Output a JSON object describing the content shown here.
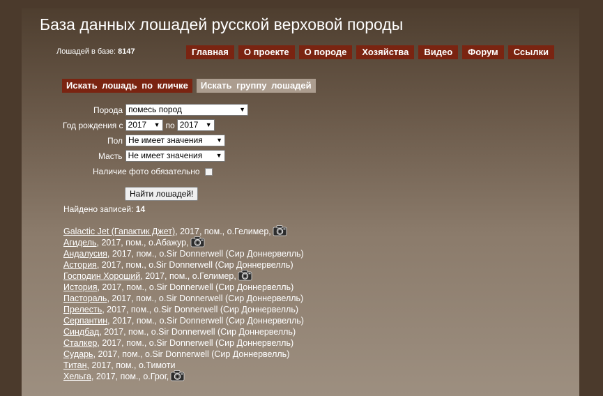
{
  "header": {
    "title": "База данных лошадей русской верховой породы",
    "count_label": "Лошадей в базе:",
    "count_value": "8147"
  },
  "nav": [
    "Главная",
    "О проекте",
    "О породе",
    "Хозяйства",
    "Видео",
    "Форум",
    "Ссылки"
  ],
  "tabs": {
    "by_name": "Искать лошадь по кличке",
    "by_group": "Искать группу лошадей"
  },
  "form": {
    "breed_label": "Порода",
    "breed_value": "помесь пород",
    "year_label": "Год рождения с",
    "year_from": "2017",
    "year_to_label": "по",
    "year_to": "2017",
    "sex_label": "Пол",
    "sex_value": "Не имеет значения",
    "color_label": "Масть",
    "color_value": "Не имеет значения",
    "photo_label": "Наличие фото обязательно",
    "submit_label": "Найти лошадей!"
  },
  "results_summary": {
    "label": "Найдено записей:",
    "count": "14"
  },
  "results": [
    {
      "name": "Galactic Jet (Гапактик Джет)",
      "info": ", 2017, пом., о.Гелимер,",
      "photo": true
    },
    {
      "name": "Агидель",
      "info": ", 2017, пом., о.Абажур,",
      "photo": true
    },
    {
      "name": "Андалусия",
      "info": ", 2017, пом., о.Sir Donnerwell (Сир Доннервелль)",
      "photo": false
    },
    {
      "name": "Астория",
      "info": ", 2017, пом., о.Sir Donnerwell (Сир Доннервелль)",
      "photo": false
    },
    {
      "name": "Господин Хороший",
      "info": ", 2017, пом., о.Гелимер,",
      "photo": true
    },
    {
      "name": "История",
      "info": ", 2017, пом., о.Sir Donnerwell (Сир Доннервелль)",
      "photo": false
    },
    {
      "name": "Пастораль",
      "info": ", 2017, пом., о.Sir Donnerwell (Сир Доннервелль)",
      "photo": false
    },
    {
      "name": "Прелесть",
      "info": ", 2017, пом., о.Sir Donnerwell (Сир Доннервелль)",
      "photo": false
    },
    {
      "name": "Серпантин",
      "info": ", 2017, пом., о.Sir Donnerwell (Сир Доннервелль)",
      "photo": false
    },
    {
      "name": "Синдбад",
      "info": ", 2017, пом., о.Sir Donnerwell (Сир Доннервелль)",
      "photo": false
    },
    {
      "name": "Сталкер",
      "info": ", 2017, пом., о.Sir Donnerwell (Сир Доннервелль)",
      "photo": false
    },
    {
      "name": "Сударь",
      "info": ", 2017, пом., о.Sir Donnerwell (Сир Доннервелль)",
      "photo": false
    },
    {
      "name": "Титан",
      "info": ", 2017, пом., о.Тимоти",
      "photo": false
    },
    {
      "name": "Хельга",
      "info": ", 2017, пом., о.Грог,",
      "photo": true
    }
  ]
}
